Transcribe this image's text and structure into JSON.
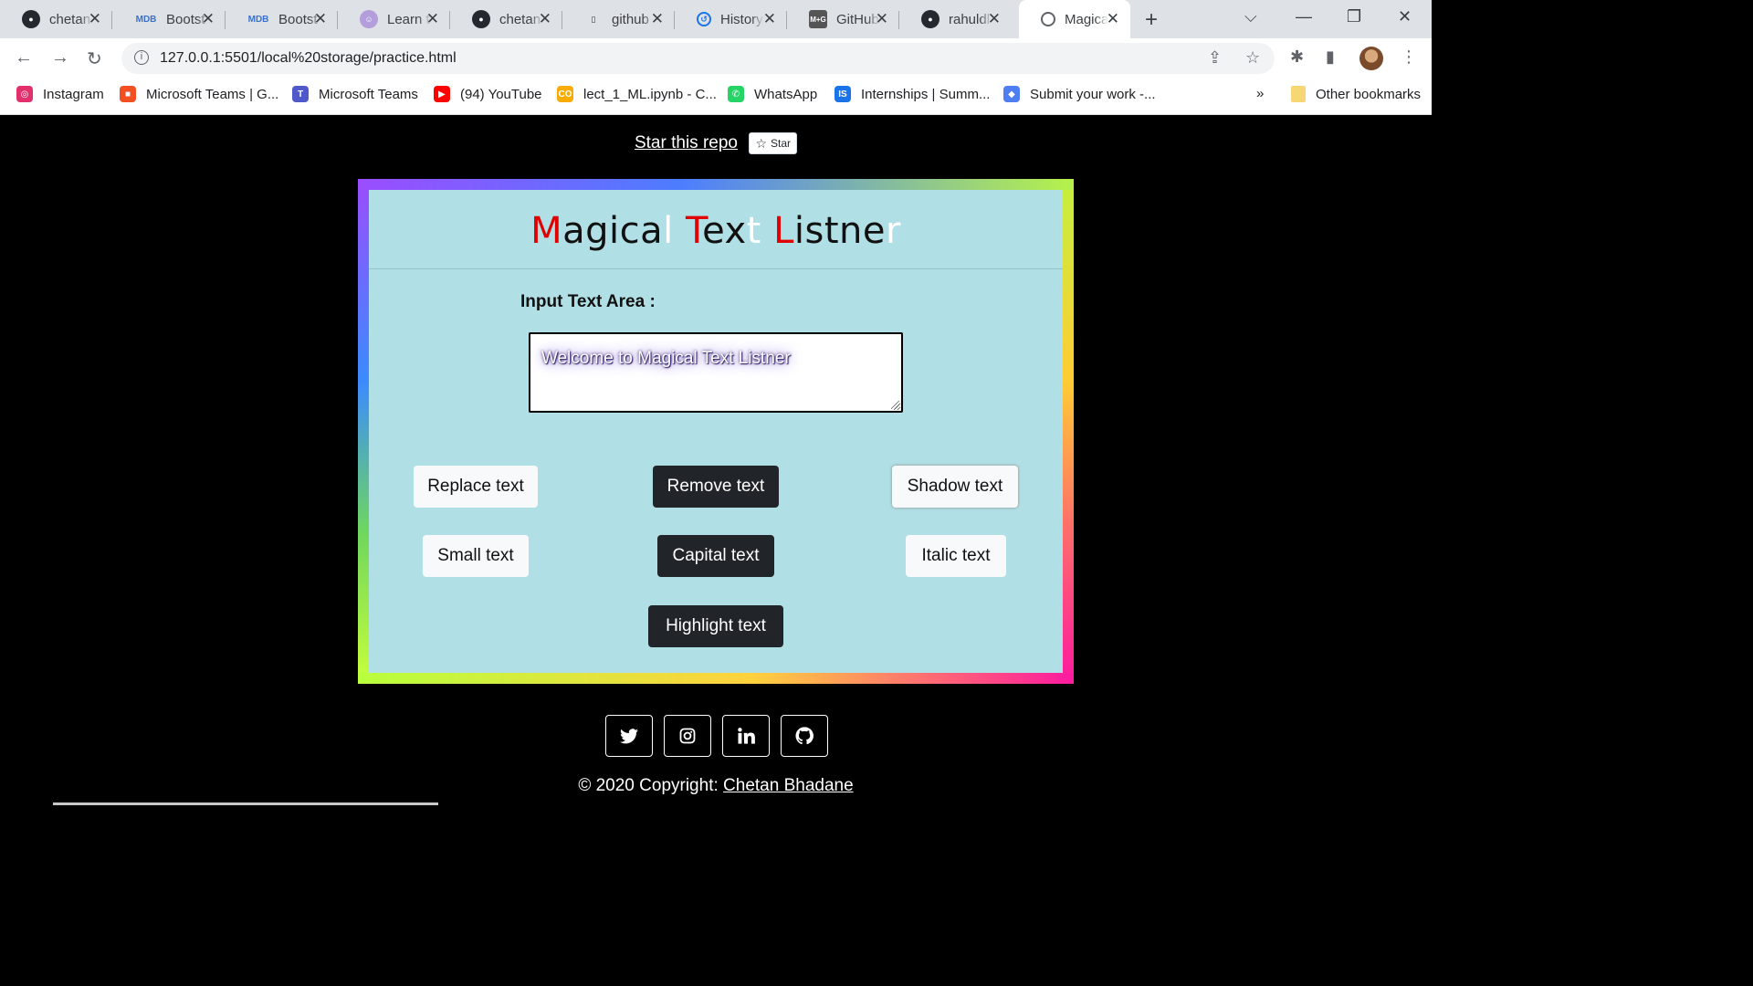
{
  "browser": {
    "tabs": [
      {
        "title": "chetan",
        "icon": "github-icon"
      },
      {
        "title": "Bootst",
        "icon": "mdb-icon"
      },
      {
        "title": "Bootst",
        "icon": "mdb-icon"
      },
      {
        "title": "Learn t",
        "icon": "avatar-icon"
      },
      {
        "title": "chetan",
        "icon": "github-icon"
      },
      {
        "title": "github",
        "icon": "book-icon"
      },
      {
        "title": "History",
        "icon": "history-icon"
      },
      {
        "title": "GitHub",
        "icon": "mg-icon"
      },
      {
        "title": "rahuldl",
        "icon": "github-icon"
      },
      {
        "title": "Magica",
        "icon": "globe-icon",
        "active": true
      }
    ],
    "url": "127.0.0.1:5501/local%20storage/practice.html",
    "bookmarks": [
      {
        "label": "Instagram",
        "icon": "instagram-icon",
        "color": "#e1306c"
      },
      {
        "label": "Microsoft Teams | G...",
        "icon": "microsoft-icon",
        "color": "#f25022"
      },
      {
        "label": "Microsoft Teams",
        "icon": "teams-icon",
        "color": "#5059c9"
      },
      {
        "label": "(94) YouTube",
        "icon": "youtube-icon",
        "color": "#ff0000"
      },
      {
        "label": "lect_1_ML.ipynb - C...",
        "icon": "colab-icon",
        "color": "#f9ab00"
      },
      {
        "label": "WhatsApp",
        "icon": "whatsapp-icon",
        "color": "#25d366"
      },
      {
        "label": "Internships | Summ...",
        "icon": "internshala-icon",
        "color": "#1a73e8"
      },
      {
        "label": "Submit your work -...",
        "icon": "diamond-icon",
        "color": "#4f7df2"
      }
    ],
    "bookmarks_overflow": "»",
    "other_bookmarks": "Other bookmarks"
  },
  "page": {
    "star_link": "Star this repo",
    "star_button": "Star",
    "title_parts": [
      {
        "t": "M",
        "c": "r"
      },
      {
        "t": "agica",
        "c": "b"
      },
      {
        "t": "l",
        "c": "w"
      },
      {
        "t": " ",
        "c": "b"
      },
      {
        "t": "T",
        "c": "r"
      },
      {
        "t": "ex",
        "c": "b"
      },
      {
        "t": "t",
        "c": "w"
      },
      {
        "t": " ",
        "c": "b"
      },
      {
        "t": "L",
        "c": "r"
      },
      {
        "t": "istne",
        "c": "b"
      },
      {
        "t": "r",
        "c": "w"
      }
    ],
    "input_label": "Input Text Area :",
    "textarea_value": "Welcome to Magical Text Listner",
    "buttons": {
      "replace": "Replace text",
      "remove": "Remove text",
      "shadow": "Shadow text",
      "small": "Small text",
      "capital": "Capital text",
      "italic": "Italic text",
      "highlight": "Highlight text"
    },
    "social_icons": [
      "twitter-icon",
      "instagram-icon",
      "linkedin-icon",
      "github-icon"
    ],
    "copyright_prefix": "© 2020 Copyright: ",
    "copyright_name": "Chetan Bhadane"
  },
  "colors": {
    "accent_red": "#e00000",
    "card_bg": "#b0dfe5",
    "dark_button": "#212529",
    "light_button": "#f8f9fa"
  }
}
